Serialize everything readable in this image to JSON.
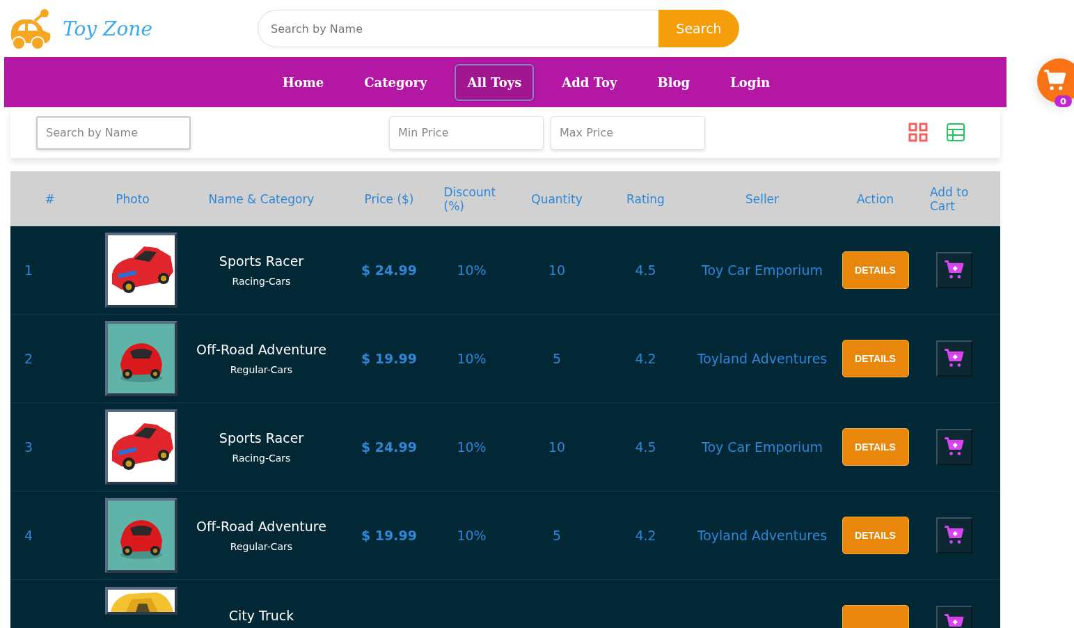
{
  "brand": {
    "name": "Toy Zone"
  },
  "header_search": {
    "placeholder": "Search by Name",
    "button": "Search"
  },
  "nav": [
    {
      "label": "Home",
      "selected": false
    },
    {
      "label": "Category",
      "selected": false
    },
    {
      "label": "All Toys",
      "selected": true
    },
    {
      "label": "Add Toy",
      "selected": false
    },
    {
      "label": "Blog",
      "selected": false
    },
    {
      "label": "Login",
      "selected": false
    }
  ],
  "cart": {
    "count": "0"
  },
  "filters": {
    "name_placeholder": "Search by Name",
    "min_placeholder": "Min Price",
    "max_placeholder": "Max Price"
  },
  "view": {
    "grid_selected": false,
    "table_selected": true
  },
  "table": {
    "columns": [
      "#",
      "Photo",
      "Name & Category",
      "Price ($)",
      "Discount (%)",
      "Quantity",
      "Rating",
      "Seller",
      "Action",
      "Add to Cart"
    ],
    "rows": [
      {
        "index": "1",
        "name": "Sports Racer",
        "category": "Racing-Cars",
        "price": "$ 24.99",
        "discount": "10%",
        "quantity": "10",
        "rating": "4.5",
        "seller": "Toy Car Emporium",
        "action": "DETAILS"
      },
      {
        "index": "2",
        "name": "Off-Road Adventure",
        "category": "Regular-Cars",
        "price": "$ 19.99",
        "discount": "10%",
        "quantity": "5",
        "rating": "4.2",
        "seller": "Toyland Adventures",
        "action": "DETAILS"
      },
      {
        "index": "3",
        "name": "Sports Racer",
        "category": "Racing-Cars",
        "price": "$ 24.99",
        "discount": "10%",
        "quantity": "10",
        "rating": "4.5",
        "seller": "Toy Car Emporium",
        "action": "DETAILS"
      },
      {
        "index": "4",
        "name": "Off-Road Adventure",
        "category": "Regular-Cars",
        "price": "$ 19.99",
        "discount": "10%",
        "quantity": "5",
        "rating": "4.2",
        "seller": "Toyland Adventures",
        "action": "DETAILS"
      },
      {
        "name": "City Truck"
      }
    ]
  }
}
